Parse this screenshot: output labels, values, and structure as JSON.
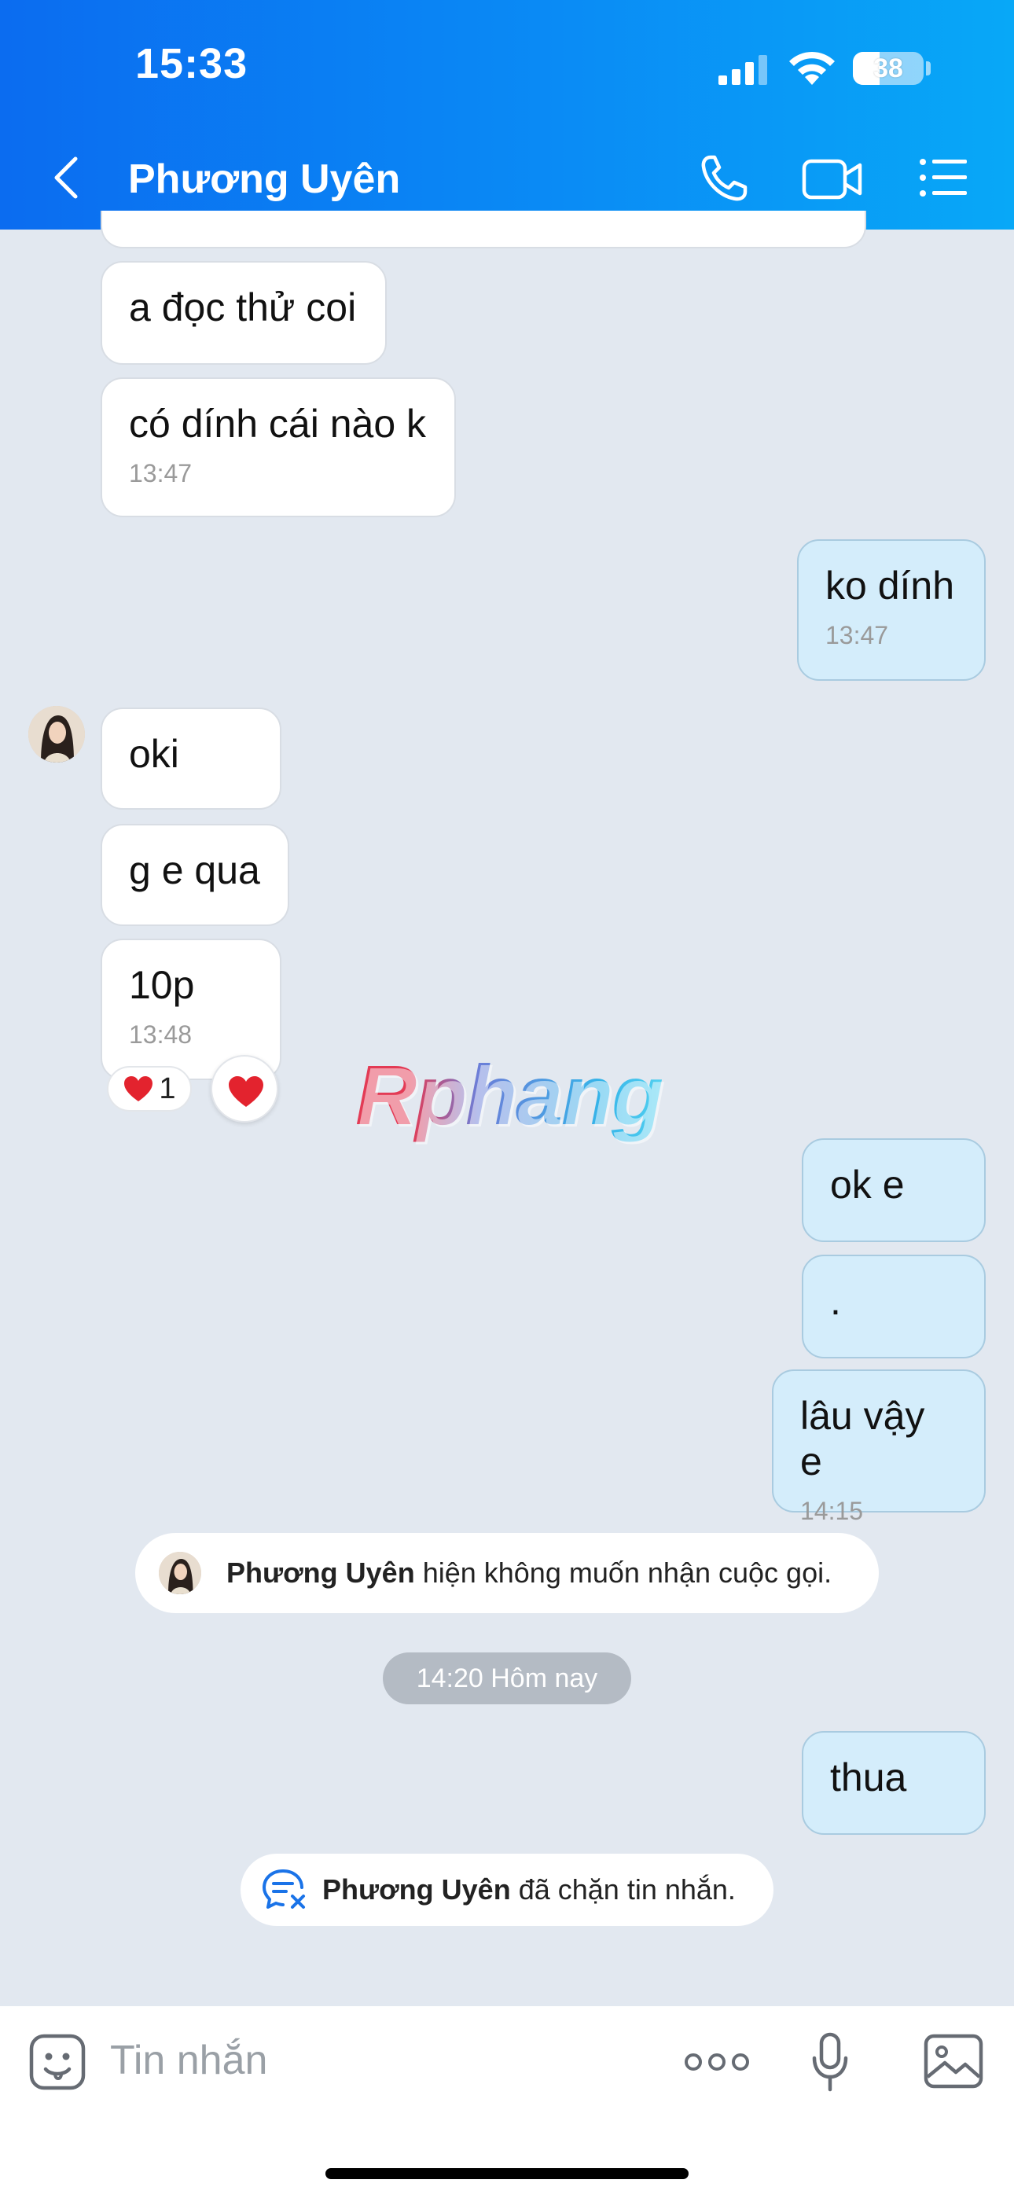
{
  "status_bar": {
    "time": "15:33",
    "battery": "38"
  },
  "header": {
    "title": "Phương Uyên"
  },
  "messages": [
    {
      "text": "a đọc thử coi"
    },
    {
      "text": "có dính cái nào k",
      "time": "13:47"
    },
    {
      "text": "ko dính",
      "time": "13:47"
    },
    {
      "text": "oki"
    },
    {
      "text": "g e qua"
    },
    {
      "text": "10p",
      "time": "13:48",
      "reaction_count": "1"
    },
    {
      "text": "ok e"
    },
    {
      "text": "."
    },
    {
      "text": "lâu vậy e",
      "time": "14:15"
    },
    {
      "text": "thua"
    }
  ],
  "system": {
    "call_notice_name": "Phương Uyên",
    "call_notice_text": "hiện không muốn nhận cuộc gọi.",
    "date_separator": "14:20 Hôm nay",
    "block_notice_name": "Phương Uyên",
    "block_notice_text": "đã chặn tin nhắn."
  },
  "watermark": "Rphang",
  "input": {
    "placeholder": "Tin nhắn"
  },
  "icons": [
    "back-icon",
    "phone-icon",
    "video-call-icon",
    "menu-list-icon",
    "sticker-icon",
    "more-icon",
    "microphone-icon",
    "image-icon",
    "heart-icon",
    "message-blocked-icon"
  ],
  "colors": {
    "header_start": "#0b6cf0",
    "header_end": "#08a8f7",
    "outgoing_bubble": "#d4edfb",
    "incoming_bubble": "#ffffff",
    "chat_bg": "#e2e8f0"
  }
}
